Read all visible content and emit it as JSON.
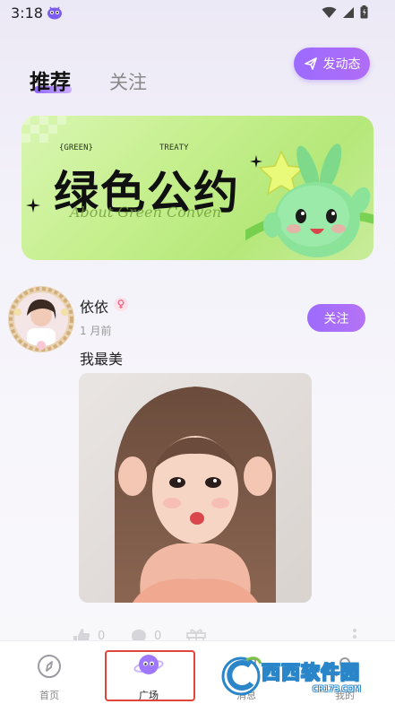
{
  "status_bar": {
    "time": "3:18",
    "icons": [
      "app-mascot-icon",
      "wifi-icon",
      "signal-icon",
      "battery-icon"
    ]
  },
  "header": {
    "tabs": [
      {
        "label": "推荐",
        "active": true
      },
      {
        "label": "关注",
        "active": false
      }
    ],
    "post_button": {
      "label": "发动态",
      "icon": "send-icon"
    }
  },
  "banner": {
    "tag_left": "{GREEN}",
    "tag_right": "TREATY",
    "title": "绿色公约",
    "subtitle": "About Green Conven",
    "colors": {
      "bg": "#c6ef8e",
      "mascot": "#8be08f"
    }
  },
  "post": {
    "username": "依依",
    "gender": "female",
    "time": "1 月前",
    "follow_label": "关注",
    "text": "我最美",
    "actions": {
      "like_count": "0",
      "comment_count": "0"
    }
  },
  "bottom_nav": {
    "items": [
      {
        "label": "首页",
        "icon": "compass-icon",
        "active": false
      },
      {
        "label": "广场",
        "icon": "planet-icon",
        "active": true
      },
      {
        "label": "消息",
        "icon": "message-icon",
        "active": false
      },
      {
        "label": "我的",
        "icon": "profile-icon",
        "active": false
      }
    ]
  },
  "watermark": {
    "text": "西西软件园",
    "url": "CR173.COM"
  },
  "colors": {
    "accent": "#a06cff",
    "highlight_box": "#e0453a"
  }
}
